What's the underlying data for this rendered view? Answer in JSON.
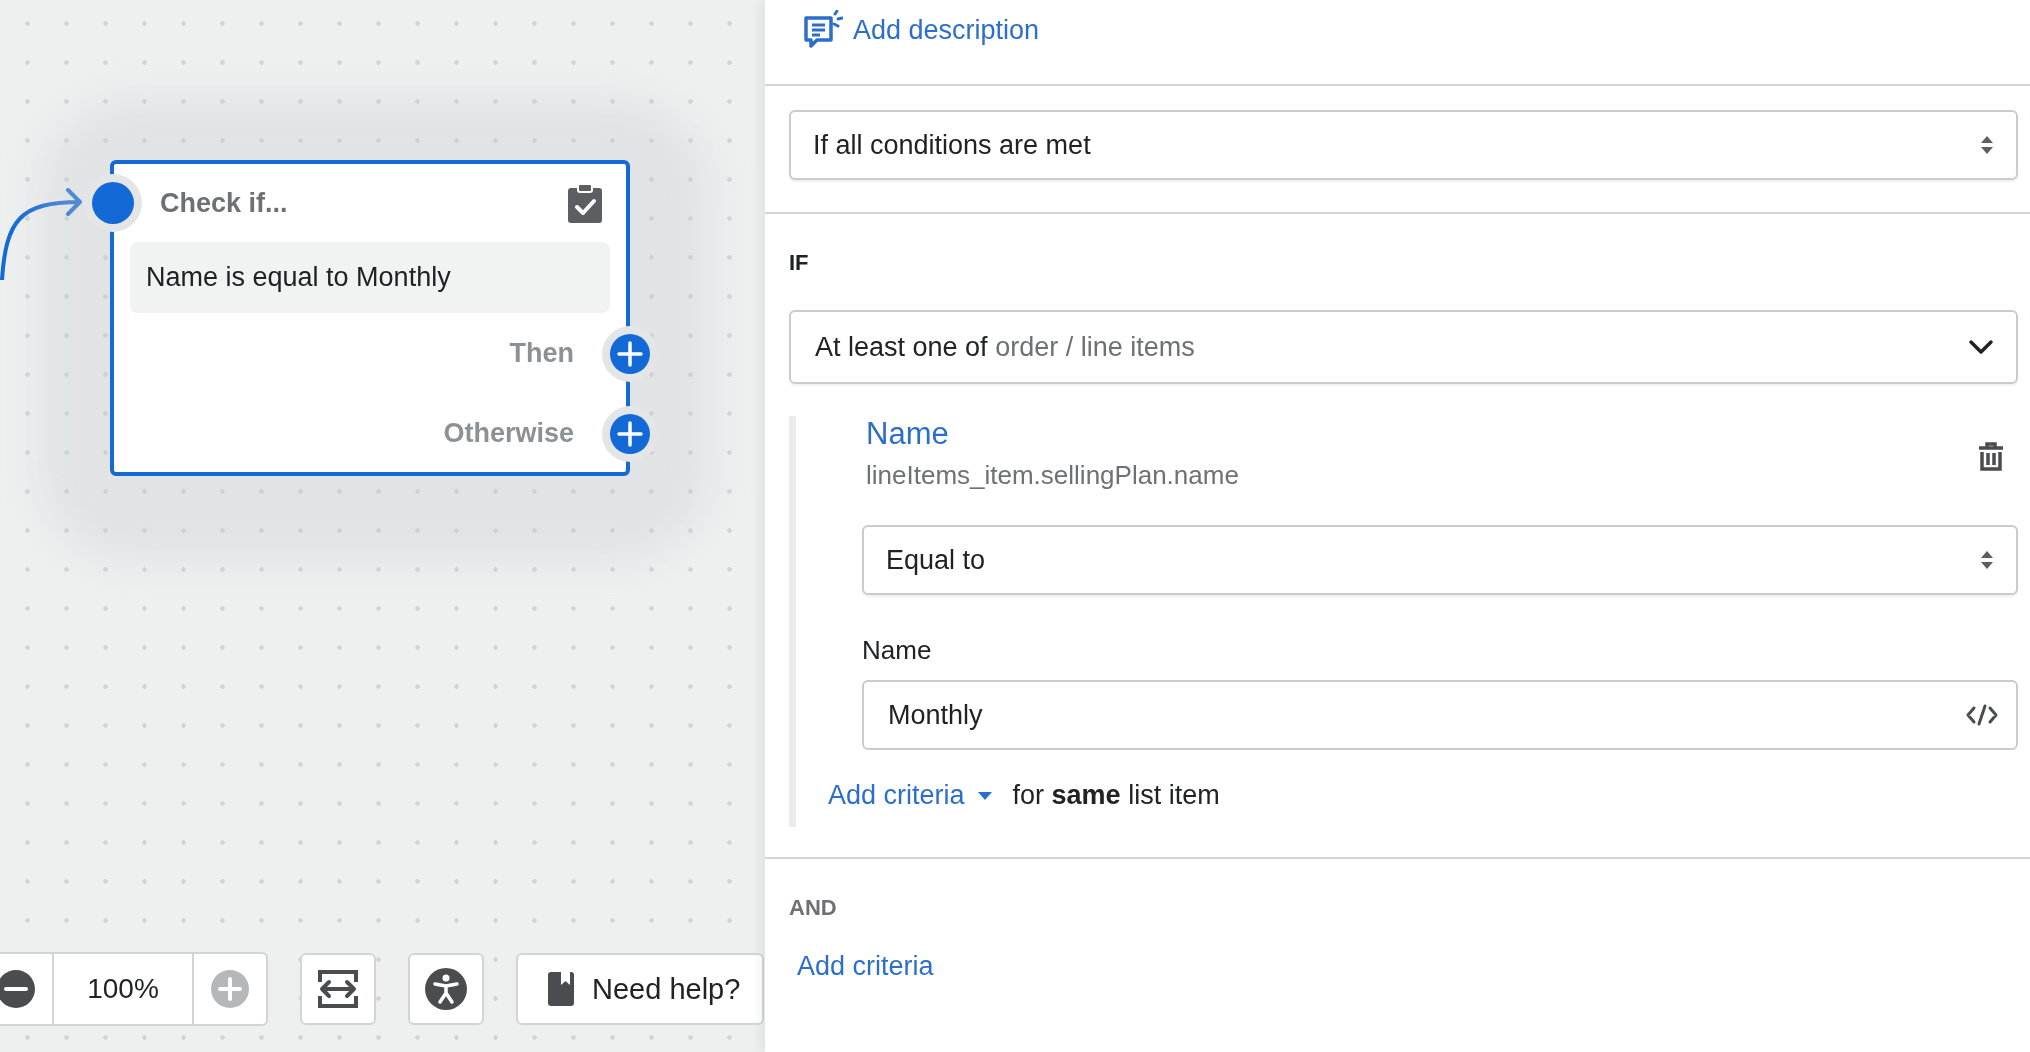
{
  "canvas": {
    "node": {
      "title": "Check if...",
      "condition": "Name is equal to Monthly",
      "outputs": [
        {
          "label": "Then"
        },
        {
          "label": "Otherwise"
        }
      ]
    },
    "toolbar": {
      "zoom_out": {
        "disabled": false
      },
      "zoom": "100%",
      "zoom_in": {
        "disabled": true
      },
      "help_button": "Need help?"
    }
  },
  "panel": {
    "add_description": "Add description",
    "match_select": "If all conditions are met",
    "if_label": "IF",
    "scope_select": {
      "prefix": "At least one of",
      "path": "order / line items"
    },
    "criteria": [
      {
        "title": "Name",
        "path": "lineItems_item.sellingPlan.name",
        "operator": "Equal to",
        "value_label": "Name",
        "value": "Monthly"
      }
    ],
    "add_criteria_same": {
      "link": "Add criteria",
      "text": "for **same** list item"
    },
    "and_label": "AND",
    "add_criteria": "Add criteria"
  }
}
